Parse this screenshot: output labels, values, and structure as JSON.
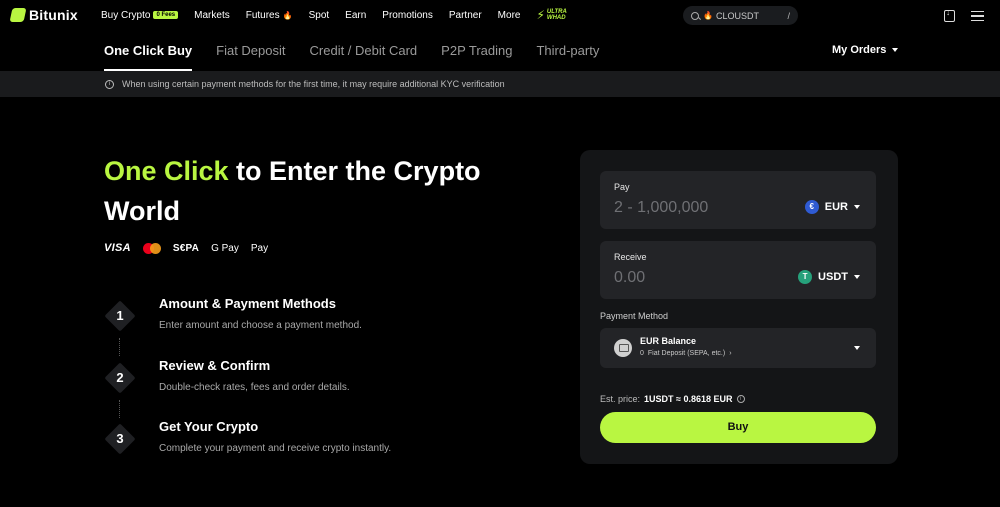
{
  "brand": {
    "name": "Bitunix",
    "accent": "#b9f641"
  },
  "nav": {
    "items": [
      {
        "label": "Buy Crypto",
        "badge": "0 Fees"
      },
      {
        "label": "Markets"
      },
      {
        "label": "Futures"
      },
      {
        "label": "Spot"
      },
      {
        "label": "Earn"
      },
      {
        "label": "Promotions"
      },
      {
        "label": "Partner"
      },
      {
        "label": "More"
      }
    ],
    "promo": {
      "line1": "ULTRA",
      "line2": "WHAD"
    },
    "search": {
      "value": "CLOUSDT",
      "shortcut": "/"
    }
  },
  "tabs": [
    {
      "label": "One Click Buy",
      "active": true
    },
    {
      "label": "Fiat Deposit"
    },
    {
      "label": "Credit / Debit Card"
    },
    {
      "label": "P2P Trading"
    },
    {
      "label": "Third-party"
    }
  ],
  "my_orders": "My Orders",
  "notice": "When using certain payment methods for the first time, it may require additional KYC verification",
  "hero": {
    "title_accent": "One Click",
    "title_rest": " to Enter the Crypto World"
  },
  "pay_logos": {
    "visa": "VISA",
    "sepa": "S€PA",
    "gpay": "G Pay",
    "apay": " Pay"
  },
  "steps": [
    {
      "num": "1",
      "title": "Amount & Payment Methods",
      "desc": "Enter amount and choose a payment method."
    },
    {
      "num": "2",
      "title": "Review & Confirm",
      "desc": "Double-check rates, fees and order details."
    },
    {
      "num": "3",
      "title": "Get Your Crypto",
      "desc": "Complete your payment and receive crypto instantly."
    }
  ],
  "panel": {
    "pay": {
      "label": "Pay",
      "placeholder": "2 - 1,000,000",
      "currency": "EUR",
      "icon": "€"
    },
    "receive": {
      "label": "Receive",
      "placeholder": "0.00",
      "currency": "USDT",
      "icon": "T"
    },
    "payment_method": {
      "label": "Payment Method",
      "name": "EUR Balance",
      "balance": "0",
      "method": "Fiat Deposit (SEPA, etc.)"
    },
    "est_price": {
      "label": "Est. price:",
      "value": "1USDT ≈ 0.8618 EUR"
    },
    "buy_label": "Buy"
  }
}
